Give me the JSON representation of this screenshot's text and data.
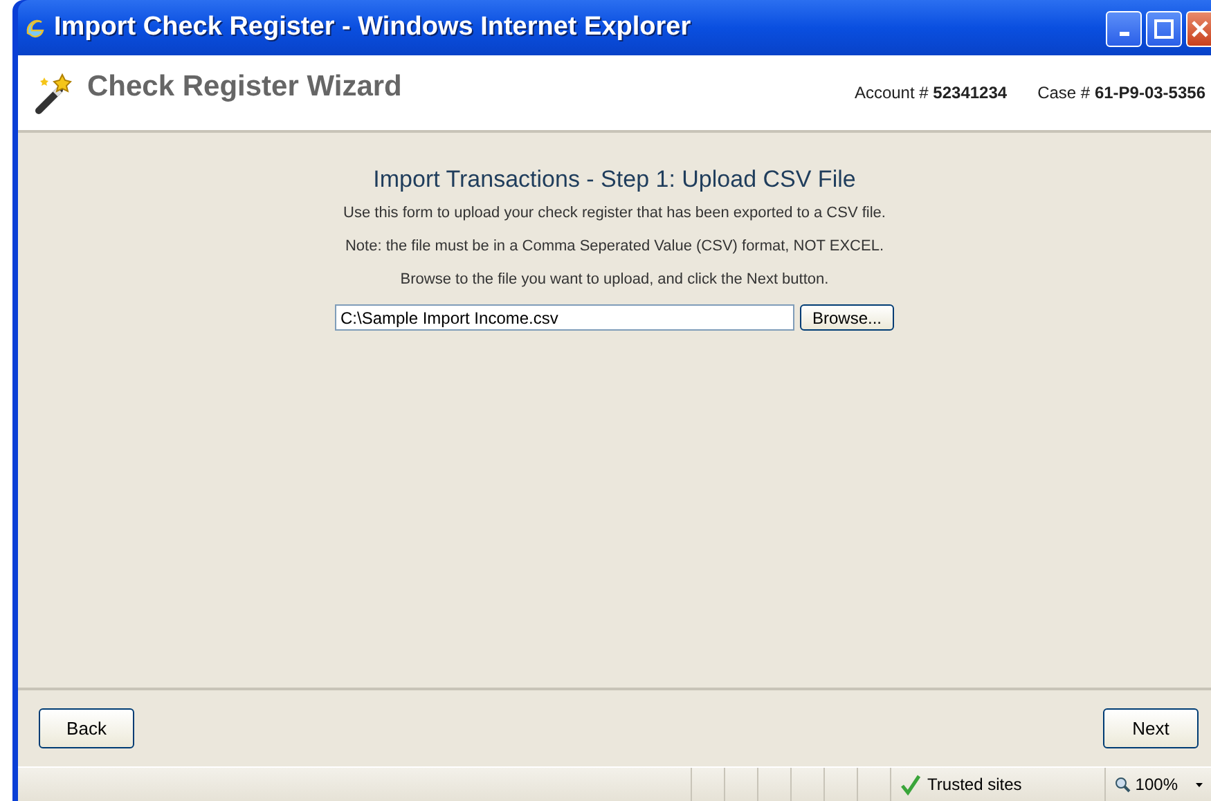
{
  "window": {
    "title": "Import Check Register - Windows Internet Explorer"
  },
  "header": {
    "title": "Check Register Wizard",
    "account_label": "Account #",
    "account": "52341234",
    "case_label": "Case #",
    "case": "61-P9-03-5356"
  },
  "form": {
    "heading": "Import Transactions - Step 1: Upload CSV File",
    "paragraphs": [
      "Use this form to upload your check register that has been exported to a CSV file.",
      "Note: the file must be in a Comma Seperated Value (CSV) format, NOT EXCEL.",
      "Browse to the file you want to upload, and click the Next button."
    ],
    "file_field": {
      "value": "C:\\Sample Import Income.csv"
    },
    "browse_button": "Browse..."
  },
  "footer": {
    "back": "Back",
    "next": "Next"
  },
  "status_bar": {
    "zone": "Trusted sites",
    "zoom": "100%"
  }
}
